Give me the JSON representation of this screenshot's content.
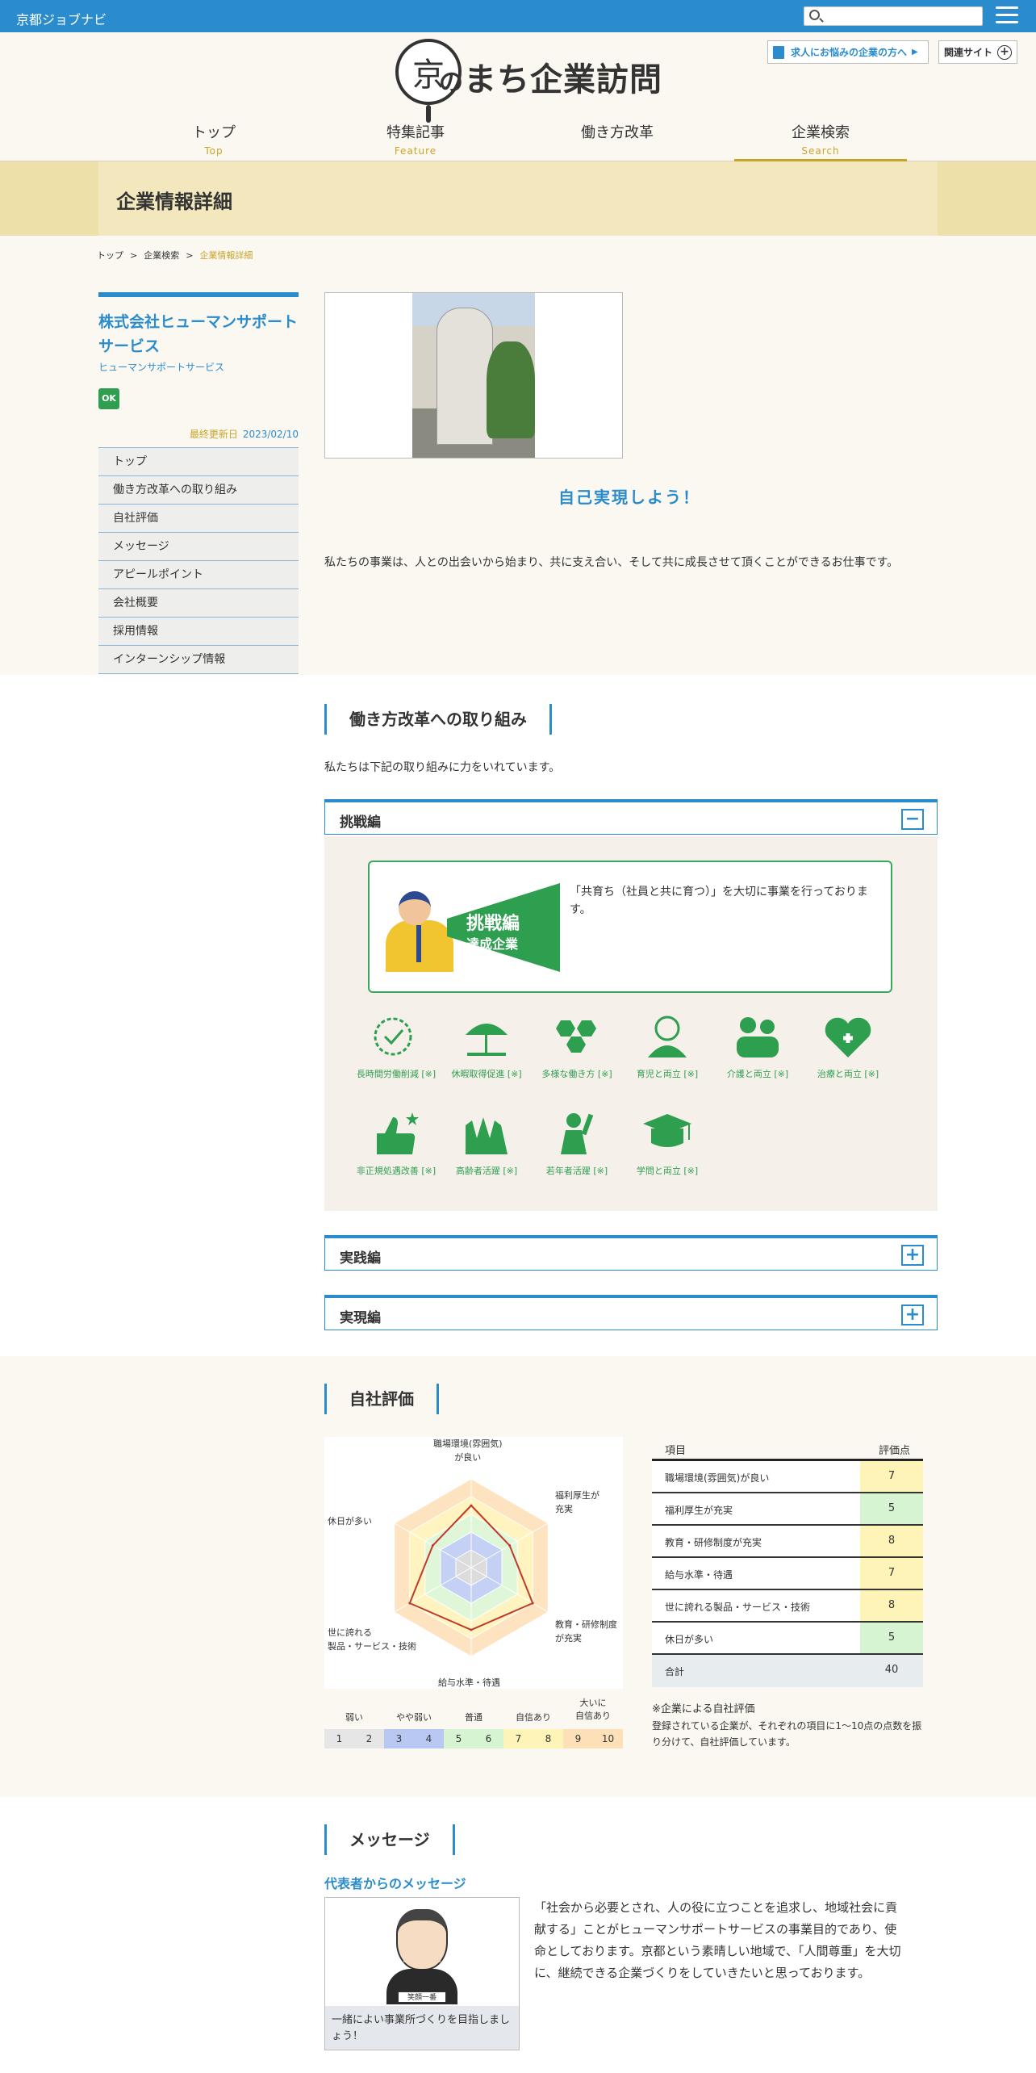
{
  "topbar": {
    "site_name": "京都ジョブナビ",
    "search_placeholder": ""
  },
  "header": {
    "logo_kanji": "京",
    "logo_no": "の",
    "logo_rest": "まち企業訪問",
    "request_btn": "求人にお悩みの企業の方へ",
    "related_btn": "関連サイト"
  },
  "nav": [
    {
      "jp": "トップ",
      "en": "Top"
    },
    {
      "jp": "特集記事",
      "en": "Feature"
    },
    {
      "jp": "働き方改革",
      "en": ""
    },
    {
      "jp": "企業検索",
      "en": "Search"
    }
  ],
  "banner": {
    "title": "企業情報詳細"
  },
  "breadcrumb": [
    "トップ",
    "企業検索",
    "企業情報詳細"
  ],
  "breadcrumb_sep": ">",
  "company": {
    "name": "株式会社ヒューマンサポートサービス",
    "kana": "ヒューマンサポートサービス",
    "badge": "OK",
    "updated_label": "最終更新日",
    "updated_date": "2023/02/10"
  },
  "side_menu": [
    "トップ",
    "働き方改革への取り組み",
    "自社評価",
    "メッセージ",
    "アピールポイント",
    "会社概要",
    "採用情報",
    "インターンシップ情報"
  ],
  "slogan": "自己実現しよう！",
  "intro": "私たちの事業は、人との出会いから始まり、共に支え合い、そして共に成長させて頂くことができるお仕事です。",
  "reform": {
    "title": "働き方改革への取り組み",
    "lead": "私たちは下記の取り組みに力をいれています。",
    "accordions": [
      {
        "label": "挑戦編",
        "toggle": "−",
        "open": true
      },
      {
        "label": "実践編",
        "toggle": "+",
        "open": false
      },
      {
        "label": "実現編",
        "toggle": "+",
        "open": false
      }
    ],
    "achieve_l1": "挑戦編",
    "achieve_l2": "達成企業",
    "achieve_text": "「共育ち（社員と共に育つ）」を大切に事業を行っております。",
    "icons": [
      {
        "label": "長時間労働削減 [※]",
        "icon": "clock-icon"
      },
      {
        "label": "休暇取得促進 [※]",
        "icon": "beach-icon"
      },
      {
        "label": "多様な働き方 [※]",
        "icon": "hexagon-icon"
      },
      {
        "label": "育児と両立 [※]",
        "icon": "childcare-icon"
      },
      {
        "label": "介護と両立 [※]",
        "icon": "nursing-care-icon"
      },
      {
        "label": "治療と両立 [※]",
        "icon": "medical-heart-icon"
      },
      {
        "label": "非正規処遇改善 [※]",
        "icon": "thumbs-up-icon"
      },
      {
        "label": "高齢者活躍 [※]",
        "icon": "senior-hands-icon"
      },
      {
        "label": "若年者活躍 [※]",
        "icon": "youth-icon"
      },
      {
        "label": "学問と両立 [※]",
        "icon": "graduation-icon"
      }
    ],
    "icon_color": "#2e9e4f"
  },
  "evaluation": {
    "title": "自社評価",
    "radar_labels": [
      "職場環境(雰囲気)\nが良い",
      "福利厚生が\n充実",
      "教育・研修制度\nが充実",
      "給与水準・待遇",
      "世に誇れる\n製品・サービス・技術",
      "休日が多い"
    ],
    "scale_levels": [
      "弱い",
      "やや弱い",
      "普通",
      "自信あり",
      "大いに\n自信あり"
    ],
    "scale_numbers": [
      "1",
      "2",
      "3",
      "4",
      "5",
      "6",
      "7",
      "8",
      "9",
      "10"
    ],
    "table_head_item": "項目",
    "table_head_score": "評価点",
    "rows": [
      {
        "item": "職場環境(雰囲気)が良い",
        "score": "7"
      },
      {
        "item": "福利厚生が充実",
        "score": "5"
      },
      {
        "item": "教育・研修制度が充実",
        "score": "8"
      },
      {
        "item": "給与水準・待遇",
        "score": "7"
      },
      {
        "item": "世に誇れる製品・サービス・技術",
        "score": "8"
      },
      {
        "item": "休日が多い",
        "score": "5"
      }
    ],
    "total_label": "合計",
    "total": "40",
    "note_title": "※企業による自社評価",
    "note_body": "登録されている企業が、それぞれの項目に1〜10点の点数を振り分けて、自社評価しています。"
  },
  "chart_data": {
    "type": "radar",
    "categories": [
      "職場環境(雰囲気)が良い",
      "福利厚生が充実",
      "教育・研修制度が充実",
      "給与水準・待遇",
      "世に誇れる製品・サービス・技術",
      "休日が多い"
    ],
    "values": [
      7,
      5,
      8,
      7,
      8,
      5
    ],
    "range": [
      0,
      10
    ],
    "line_color": "#c0392b"
  },
  "message": {
    "title": "メッセージ",
    "subtitle": "代表者からのメッセージ",
    "name_tag": "笑顔一番",
    "caption": "一緒によい事業所づくりを目指しましょう！",
    "body": "「社会から必要とされ、人の役に立つことを追求し、地域社会に貢献する」ことがヒューマンサポートサービスの事業目的であり、使命としております。京都という素晴しい地域で、「人間尊重」を大切に、継続できる企業づくりをしていきたいと思っております。"
  },
  "colors": {
    "accent": "#2a8ccd",
    "gold": "#c9a42a",
    "green": "#2e9e4f"
  }
}
